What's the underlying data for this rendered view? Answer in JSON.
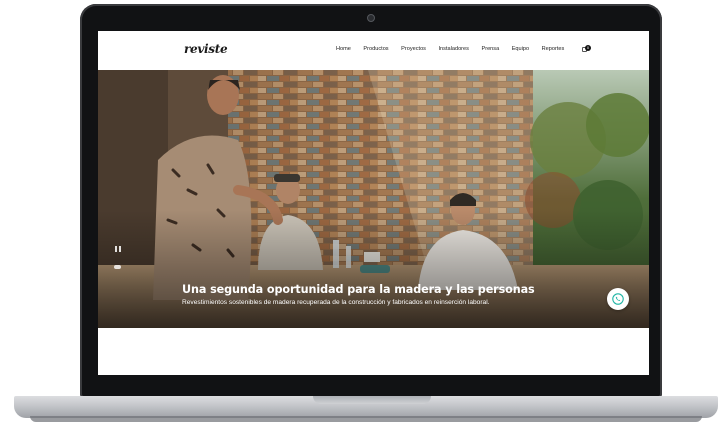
{
  "site": {
    "logo": "reviste"
  },
  "nav": {
    "links": [
      "Home",
      "Productos",
      "Proyectos",
      "Instaladores",
      "Prensa",
      "Equipo",
      "Reportes"
    ],
    "cart_count": "0"
  },
  "hero": {
    "title": "Una segunda oportunidad para la madera y las personas",
    "subtitle": "Revestimientos sostenibles de madera recuperada de la construcción y fabricados en reinserción laboral."
  },
  "colors": {
    "whatsapp_accent": "#1fb5a5",
    "laptop_frame": "#111214"
  },
  "icons": {
    "whatsapp": "whatsapp-phone-icon",
    "cart": "shopping-bag-icon",
    "pause": "pause-icon"
  }
}
